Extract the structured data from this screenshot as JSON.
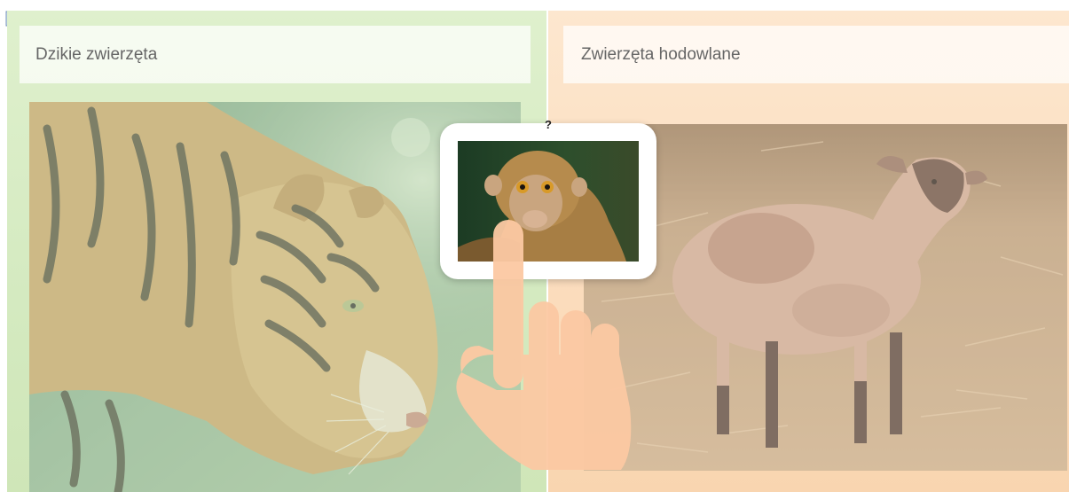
{
  "help": {
    "icon": "help-question-icon"
  },
  "categories": [
    {
      "title": "Dzikie zwierzęta",
      "image": "tiger-photo",
      "color": "#d4eac0"
    },
    {
      "title": "Zwierzęta hodowlane",
      "image": "sheep-photo",
      "color": "#fbdcbc"
    }
  ],
  "drag_item": {
    "help_label": "?",
    "image": "monkey-photo"
  },
  "hint": {
    "icon": "pointing-hand-icon"
  }
}
